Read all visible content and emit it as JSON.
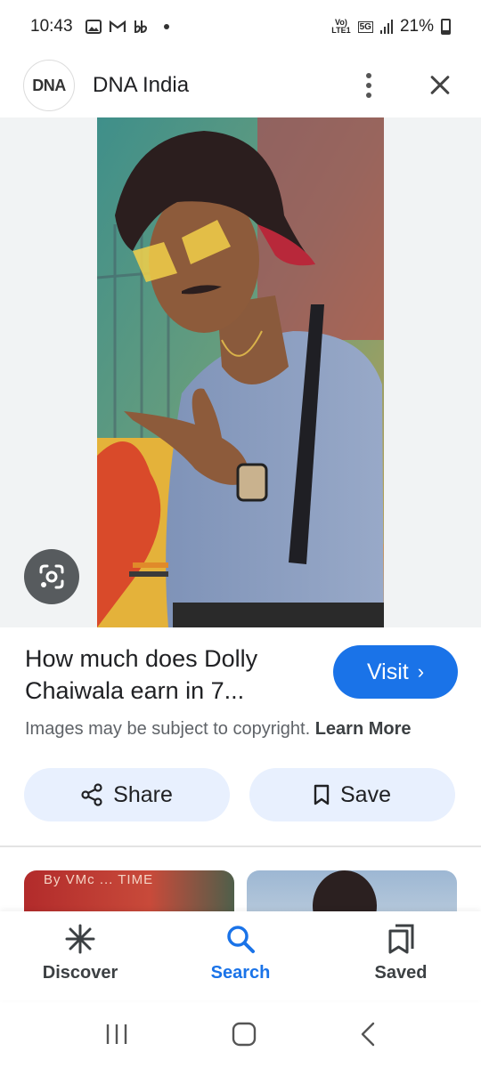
{
  "status_bar": {
    "time": "10:43",
    "notification_icons": [
      "image-icon",
      "gmail-icon",
      "bb-icon"
    ],
    "network_label_top": "Vo)",
    "network_label_bottom": "LTE1",
    "network_type": "5G",
    "battery": "21%"
  },
  "header": {
    "logo_text": "DNA",
    "site_name": "DNA India"
  },
  "result": {
    "title": "How much does Dolly Chaiwala earn in 7...",
    "visit_label": "Visit",
    "copyright_text": "Images may be subject to copyright.",
    "learn_more_label": "Learn More"
  },
  "actions": {
    "share_label": "Share",
    "save_label": "Save"
  },
  "related": {
    "thumb1_text": "By VMc ... TIME"
  },
  "bottom_nav": {
    "items": [
      {
        "label": "Discover"
      },
      {
        "label": "Search"
      },
      {
        "label": "Saved"
      }
    ],
    "active": "Search"
  },
  "colors": {
    "accent": "#1a73e8",
    "chip_bg": "#e8f0fe"
  }
}
